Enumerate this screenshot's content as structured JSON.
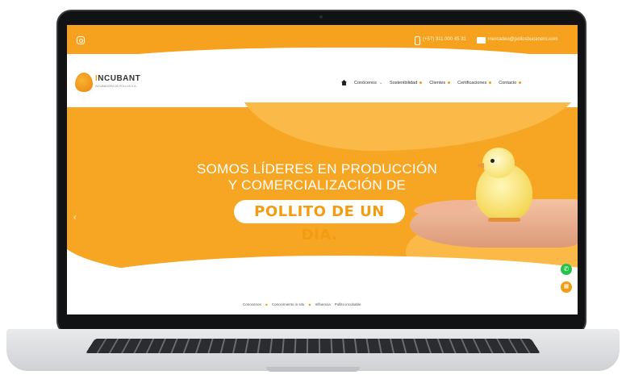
{
  "topbar": {
    "phone": "(+57) 311 000 45 31",
    "email": "mercadeo@pollosbucanero.com"
  },
  "brand": {
    "name_first": "I",
    "name_rest": "NCUBANT",
    "tagline": "INCUBADORA DE POLLOS S.A."
  },
  "nav": {
    "items": [
      {
        "label": "Conócenos"
      },
      {
        "label": "Sostenibilidad"
      },
      {
        "label": "Clientes"
      },
      {
        "label": "Certificaciones"
      },
      {
        "label": "Contacto"
      }
    ]
  },
  "hero": {
    "line1": "SOMOS LÍDERES EN PRODUCCIÓN",
    "line2": "Y COMERCIALIZACIÓN DE",
    "highlight": "POLLITO DE UN DÍA."
  },
  "footer": {
    "links": [
      "Conocenos",
      "Conocimiento in situ",
      "Influencia",
      "Pollito incubable"
    ]
  },
  "colors": {
    "brand_orange": "#f7a623",
    "whatsapp_green": "#25c24b"
  }
}
